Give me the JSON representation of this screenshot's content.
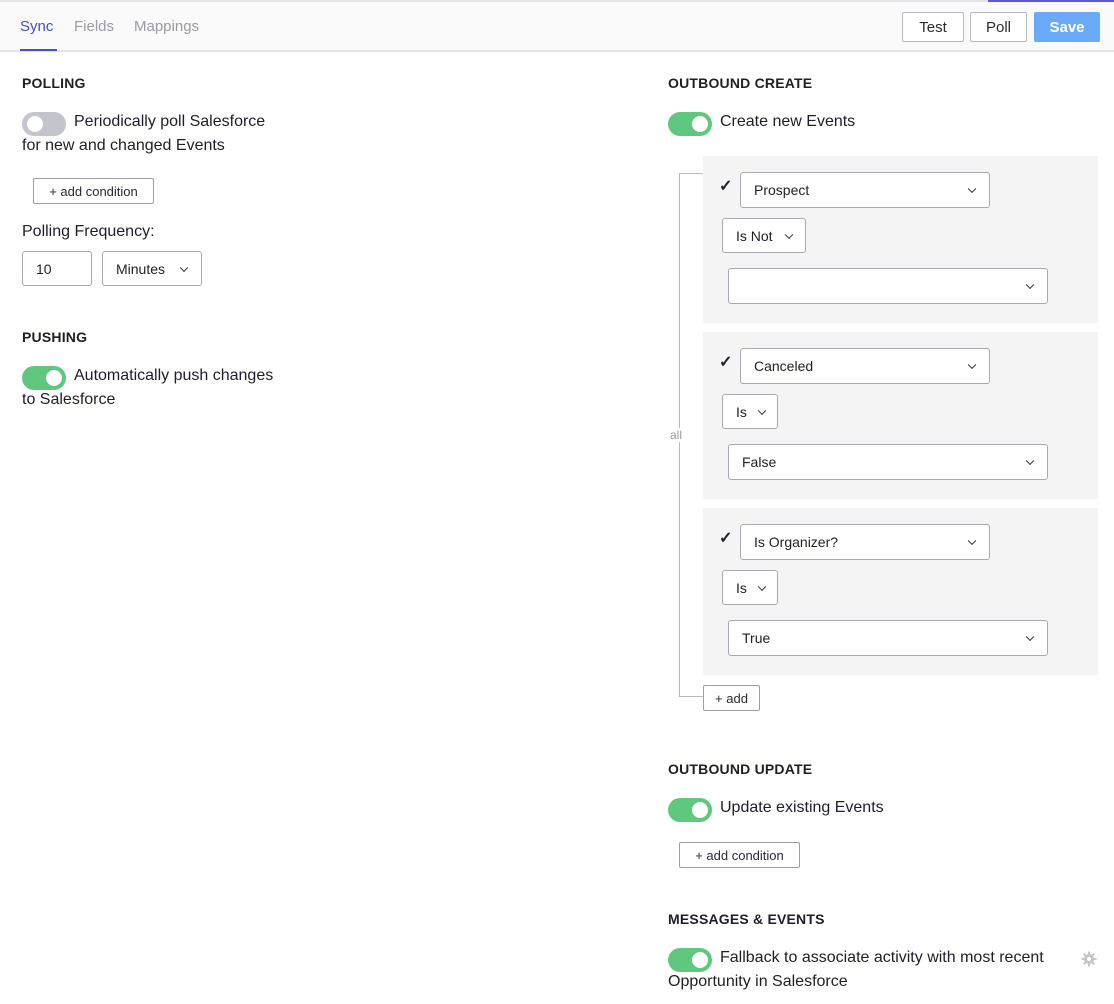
{
  "tabs": [
    {
      "label": "Sync",
      "active": true
    },
    {
      "label": "Fields",
      "active": false
    },
    {
      "label": "Mappings",
      "active": false
    }
  ],
  "toolbar": {
    "test_label": "Test",
    "poll_label": "Poll",
    "save_label": "Save"
  },
  "polling": {
    "title": "POLLING",
    "toggle_on": false,
    "label_line1": "Periodically poll Salesforce",
    "label_line2": "for new and changed Events",
    "add_condition": "+ add condition",
    "frequency_label": "Polling Frequency:",
    "frequency_value": "10",
    "frequency_unit": "Minutes"
  },
  "pushing": {
    "title": "PUSHING",
    "toggle_on": true,
    "label_line1": "Automatically push changes",
    "label_line2": "to Salesforce"
  },
  "outbound_create": {
    "title": "OUTBOUND CREATE",
    "toggle_on": true,
    "label": "Create new Events",
    "group_label": "all",
    "conditions": [
      {
        "field": "Prospect",
        "operator": "Is Not",
        "value": ""
      },
      {
        "field": "Canceled",
        "operator": "Is",
        "value": "False"
      },
      {
        "field": "Is Organizer?",
        "operator": "Is",
        "value": "True"
      }
    ],
    "add_label": "+ add"
  },
  "outbound_update": {
    "title": "OUTBOUND UPDATE",
    "toggle_on": true,
    "label": "Update existing Events",
    "add_condition": "+ add condition"
  },
  "messages_events": {
    "title": "MESSAGES & EVENTS",
    "toggle_on": true,
    "label_line1": "Fallback to associate activity with most recent",
    "label_line2": "Opportunity in Salesforce",
    "settings_icon": "gear-icon"
  },
  "colors": {
    "accent": "#4b4bcf",
    "toggle_on": "#5fc77e",
    "toggle_off": "#c4c4cc",
    "save_button": "#6aaaf8"
  }
}
